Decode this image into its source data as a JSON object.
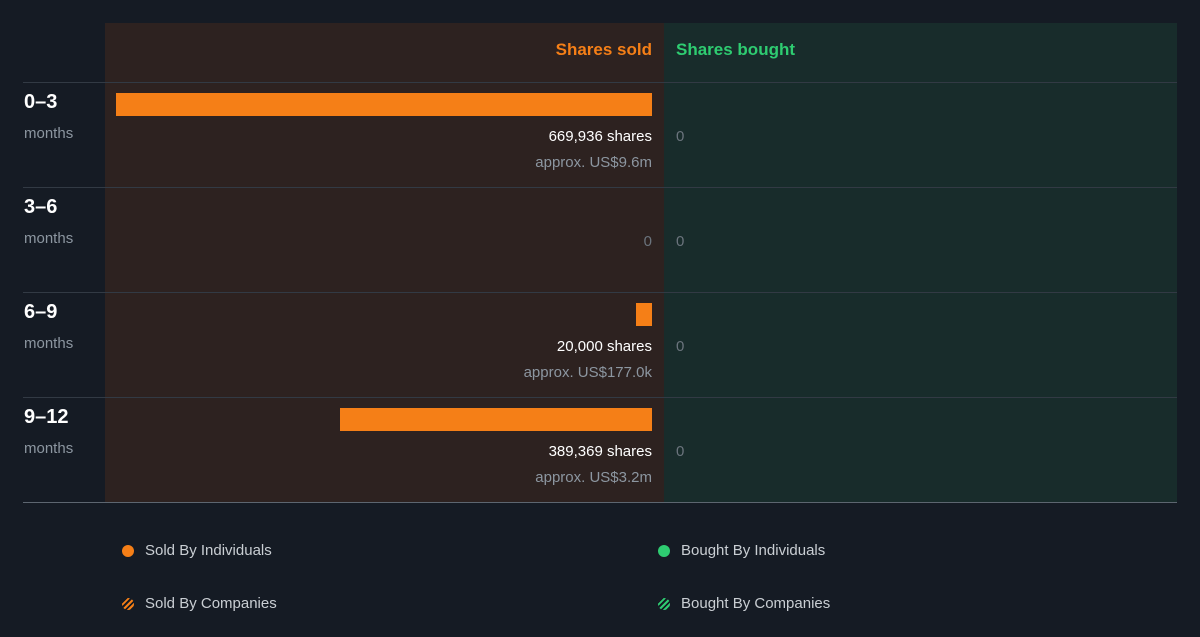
{
  "chart_data": {
    "type": "bar",
    "orientation": "horizontal-diverging",
    "headers": {
      "sold": "Shares sold",
      "bought": "Shares bought"
    },
    "categories": [
      {
        "period": "0–3",
        "unit": "months"
      },
      {
        "period": "3–6",
        "unit": "months"
      },
      {
        "period": "6–9",
        "unit": "months"
      },
      {
        "period": "9–12",
        "unit": "months"
      }
    ],
    "series": [
      {
        "name": "Shares sold",
        "values": [
          669936,
          0,
          20000,
          389369
        ],
        "labels": [
          "669,936 shares",
          "0",
          "20,000 shares",
          "389,369 shares"
        ],
        "approx": [
          "approx. US$9.6m",
          "",
          "approx. US$177.0k",
          "approx. US$3.2m"
        ]
      },
      {
        "name": "Shares bought",
        "values": [
          0,
          0,
          0,
          0
        ],
        "labels": [
          "0",
          "0",
          "0",
          "0"
        ]
      }
    ],
    "xlim": [
      0,
      669936
    ],
    "legend": [
      {
        "label": "Sold By Individuals",
        "marker": "dot",
        "color": "#f57f17"
      },
      {
        "label": "Bought By Individuals",
        "marker": "dot",
        "color": "#2ecc71"
      },
      {
        "label": "Sold By Companies",
        "marker": "striped",
        "color": "#f57f17"
      },
      {
        "label": "Bought By Companies",
        "marker": "striped",
        "color": "#2ecc71"
      }
    ],
    "legend_position": "bottom",
    "colors": {
      "sold": "#f57f17",
      "bought": "#2ecc71"
    }
  }
}
